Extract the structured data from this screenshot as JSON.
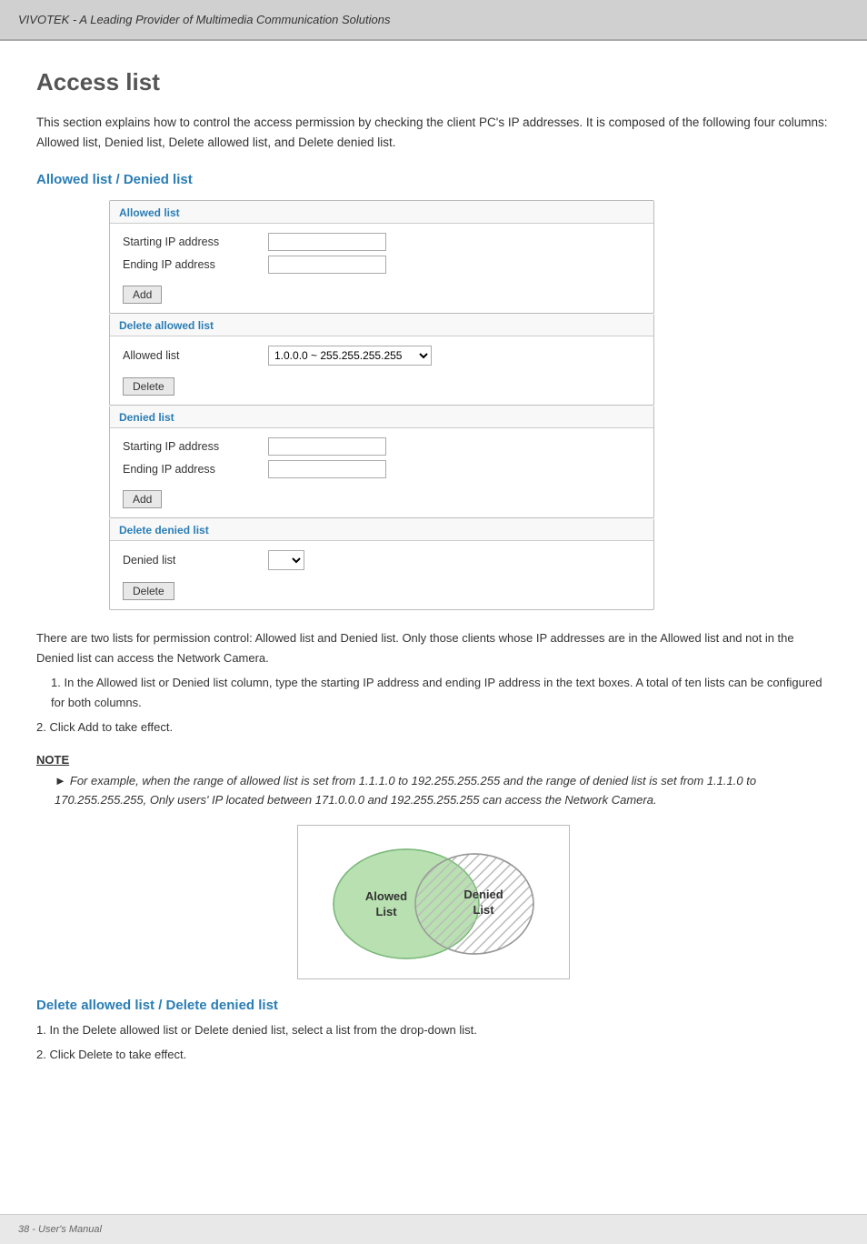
{
  "header": {
    "title": "VIVOTEK - A Leading Provider of Multimedia Communication Solutions"
  },
  "page": {
    "title": "Access list",
    "intro": "This section explains how to control the access permission by checking the client PC's IP addresses. It is composed of the following four columns: Allowed list, Denied list, Delete allowed list, and Delete denied list."
  },
  "section1": {
    "heading": "Allowed list / Denied list"
  },
  "allowed_list_panel": {
    "title": "Allowed list",
    "starting_ip_label": "Starting IP address",
    "ending_ip_label": "Ending IP address",
    "add_button": "Add"
  },
  "delete_allowed_panel": {
    "title": "Delete allowed list",
    "allowed_list_label": "Allowed list",
    "dropdown_value": "1.0.0.0 ~ 255.255.255.255",
    "delete_button": "Delete"
  },
  "denied_list_panel": {
    "title": "Denied list",
    "starting_ip_label": "Starting IP address",
    "ending_ip_label": "Ending IP address",
    "add_button": "Add"
  },
  "delete_denied_panel": {
    "title": "Delete denied list",
    "denied_list_label": "Denied list",
    "delete_button": "Delete"
  },
  "body_paragraphs": {
    "p1": "There are two lists for permission control: Allowed list and Denied list. Only those clients whose IP addresses are in the Allowed list and not in the Denied list can access the Network Camera.",
    "p2": "1. In the Allowed list or Denied list column, type the starting IP address and ending IP address in the text boxes. A total of ten lists can be configured for both columns.",
    "p3": "2. Click Add to take effect."
  },
  "note": {
    "title": "NOTE",
    "text": "For example, when the range of allowed list is set from 1.1.1.0 to 192.255.255.255 and the range of denied list is set from 1.1.1.0 to 170.255.255.255, Only users' IP located between 171.0.0.0 and 192.255.255.255 can access the Network Camera."
  },
  "diagram": {
    "allowed_label": "Alowed List",
    "denied_label": "Denied List"
  },
  "section2": {
    "heading": "Delete allowed list / Delete denied list",
    "p1": "1. In the Delete allowed list or Delete denied list, select a list from the drop-down list.",
    "p2": "2. Click Delete to take effect."
  },
  "footer": {
    "text": "38 - User's Manual"
  }
}
